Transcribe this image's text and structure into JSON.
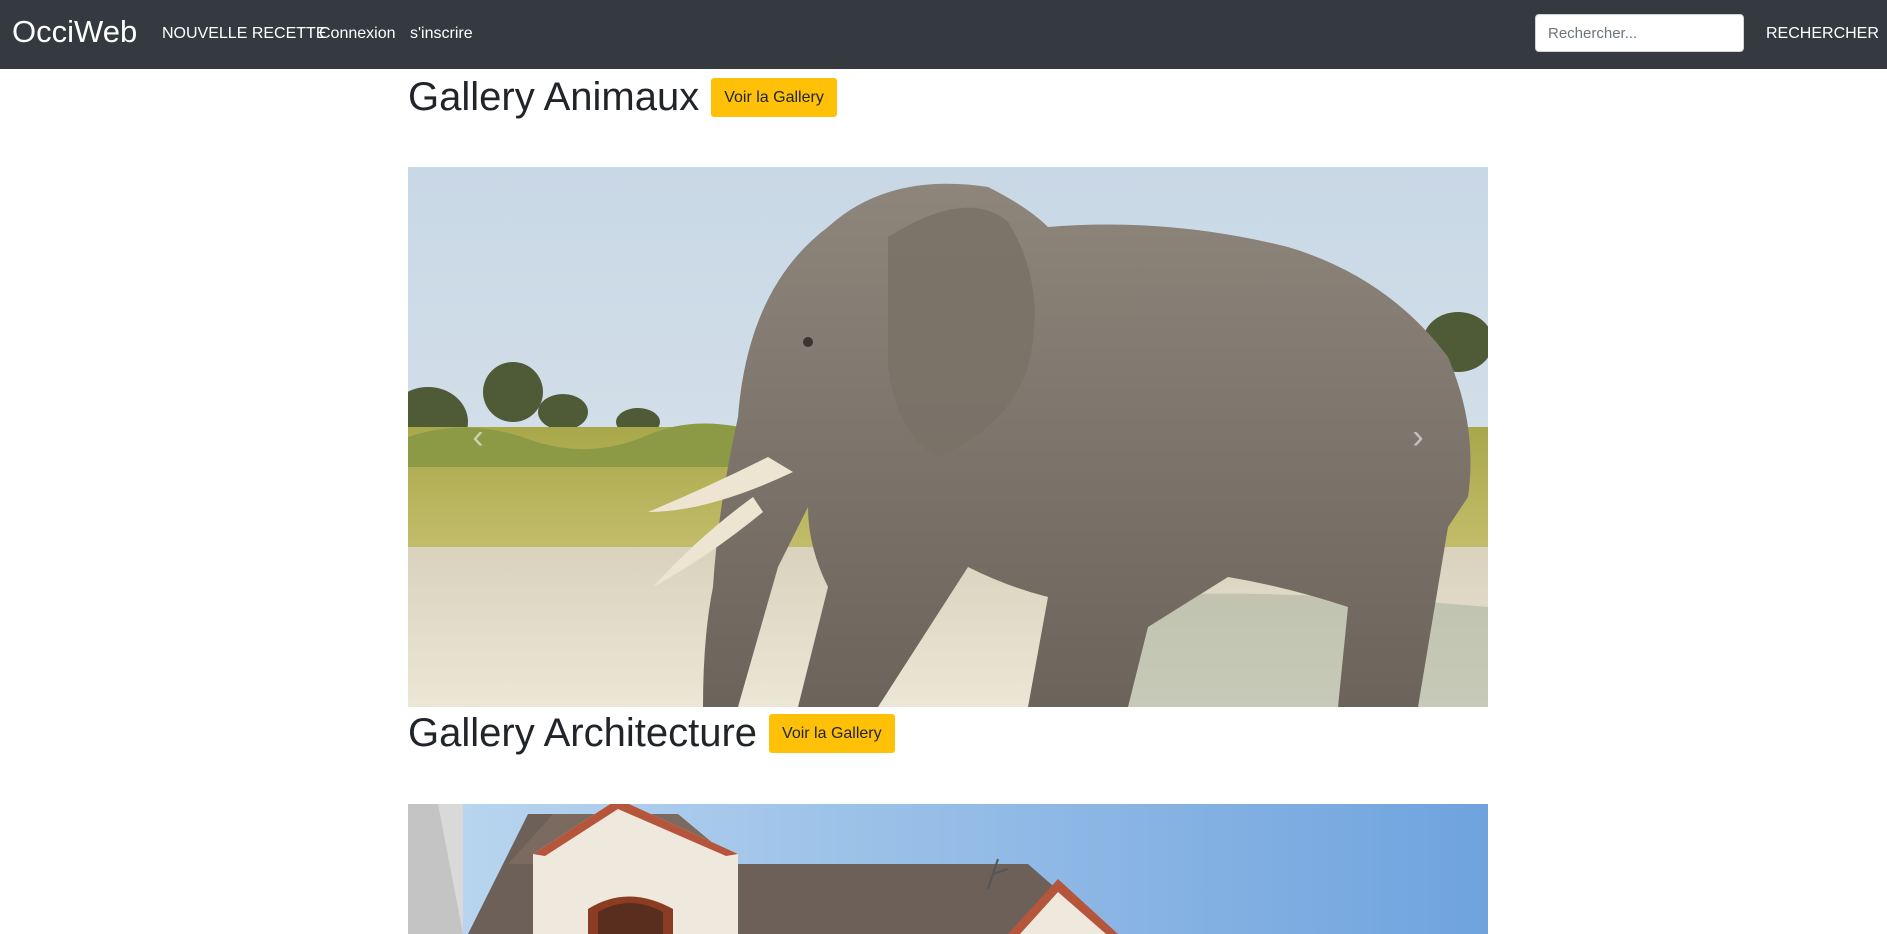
{
  "navbar": {
    "brand": "OcciWeb",
    "links": {
      "new_recipe": "NOUVELLE RECETTE",
      "login": "Connexion",
      "signup": "s'inscrire"
    },
    "search": {
      "placeholder": "Rechercher...",
      "value": "",
      "button_label": "RECHERCHER"
    }
  },
  "galleries": [
    {
      "title": "Gallery Animaux",
      "button_label": "Voir la Gallery",
      "image": "elephant"
    },
    {
      "title": "Gallery Architecture",
      "button_label": "Voir la Gallery",
      "image": "house"
    }
  ],
  "carousel_controls": {
    "prev_icon": "chevron-left-icon",
    "next_icon": "chevron-right-icon"
  },
  "colors": {
    "navbar_bg": "#343a40",
    "button_warning": "#ffc107",
    "text": "#212529"
  }
}
